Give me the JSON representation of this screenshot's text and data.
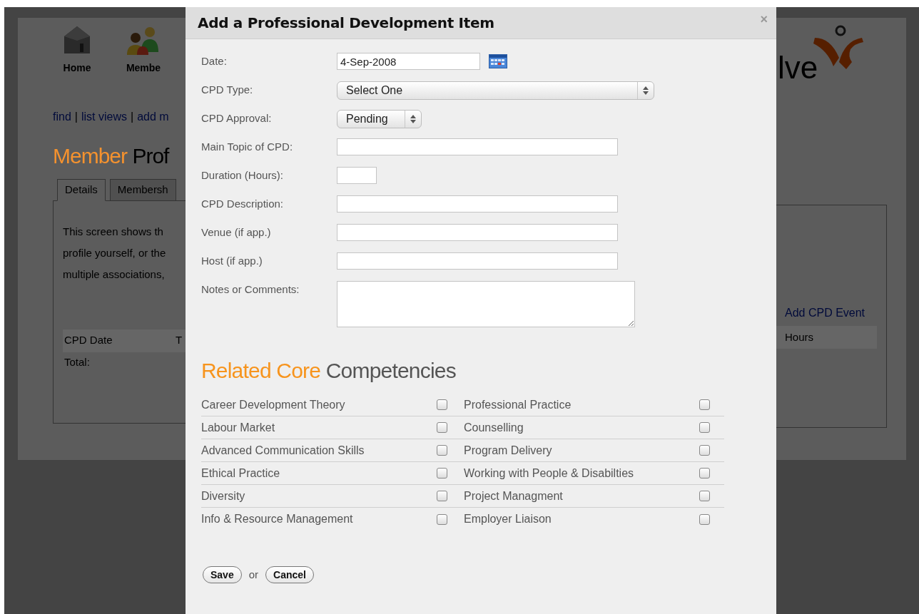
{
  "background_page": {
    "nav": [
      {
        "label": "Home",
        "kind": "house"
      },
      {
        "label": "Membe",
        "kind": "people"
      }
    ],
    "links": [
      "find",
      "list views",
      "add m"
    ],
    "link_separator": "|",
    "title_accent": "Member",
    "title_rest": "Prof",
    "tabs": [
      {
        "label": "Details",
        "selected": true
      },
      {
        "label": "Membersh",
        "selected": false
      }
    ],
    "intro_lines": [
      "This screen shows th",
      "profile yourself, or the",
      "multiple associations,"
    ],
    "table_left_columns": [
      "CPD Date",
      "T"
    ],
    "total_label": "Total:",
    "logo_text": "lve",
    "add_link": "Add CPD Event",
    "table_right_columns": [
      "Hours"
    ]
  },
  "dialog": {
    "title": "Add a Professional Development Item",
    "close": "×",
    "fields": [
      {
        "label": "Date:",
        "kind": "date",
        "value": "4-Sep-2008"
      },
      {
        "label": "CPD Type:",
        "kind": "select_wide",
        "value": "Select One"
      },
      {
        "label": "CPD Approval:",
        "kind": "select_small",
        "value": "Pending"
      },
      {
        "label": "Main Topic of CPD:",
        "kind": "text"
      },
      {
        "label": "Duration (Hours):",
        "kind": "short"
      },
      {
        "label": "CPD Description:",
        "kind": "text"
      },
      {
        "label": "Venue (if app.)",
        "kind": "text"
      },
      {
        "label": "Host (if app.)",
        "kind": "text"
      },
      {
        "label": "Notes or Comments:",
        "kind": "textarea"
      }
    ],
    "heading_accent": "Related Core",
    "heading_rest": "Competencies",
    "competencies": [
      {
        "label": "Career Development Theory",
        "checked": false
      },
      {
        "label": "Professional Practice",
        "checked": false
      },
      {
        "label": "Labour Market",
        "checked": false
      },
      {
        "label": "Counselling",
        "checked": false
      },
      {
        "label": "Advanced Communication Skills",
        "checked": false
      },
      {
        "label": "Program Delivery",
        "checked": false
      },
      {
        "label": "Ethical Practice",
        "checked": false
      },
      {
        "label": "Working with People & Disabilties",
        "checked": false
      },
      {
        "label": "Diversity",
        "checked": false
      },
      {
        "label": "Project Managment",
        "checked": false
      },
      {
        "label": "Info & Resource Management",
        "checked": false
      },
      {
        "label": "Employer Liaison",
        "checked": false
      }
    ],
    "save": "Save",
    "or": "or",
    "cancel": "Cancel"
  }
}
